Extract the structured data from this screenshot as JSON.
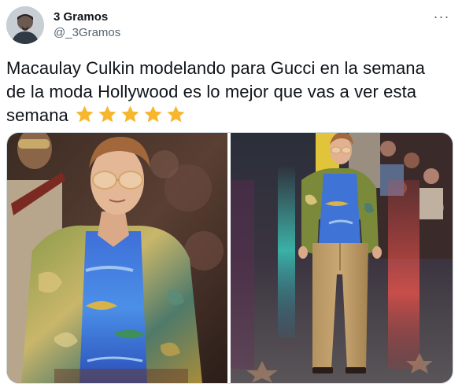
{
  "tweet": {
    "author": {
      "display_name": "3 Gramos",
      "handle": "@_3Gramos",
      "avatar_icon": "user-avatar-icon"
    },
    "more_icon": "more-options-icon",
    "text": "Macaulay Culkin modelando para Gucci en la semana de la moda Hollywood es lo mejor que vas a ver esta semana",
    "rating": {
      "stars": 5,
      "max": 5,
      "icon": "star-icon",
      "color": "#f6b72e"
    },
    "media": [
      {
        "name": "runway-closeup-photo",
        "icon": "photo-icon"
      },
      {
        "name": "runway-full-length-photo",
        "icon": "photo-icon"
      }
    ]
  },
  "colors": {
    "text": "#0f1419",
    "secondary": "#536471",
    "border": "#cfd9de",
    "star": "#f6b72e"
  }
}
